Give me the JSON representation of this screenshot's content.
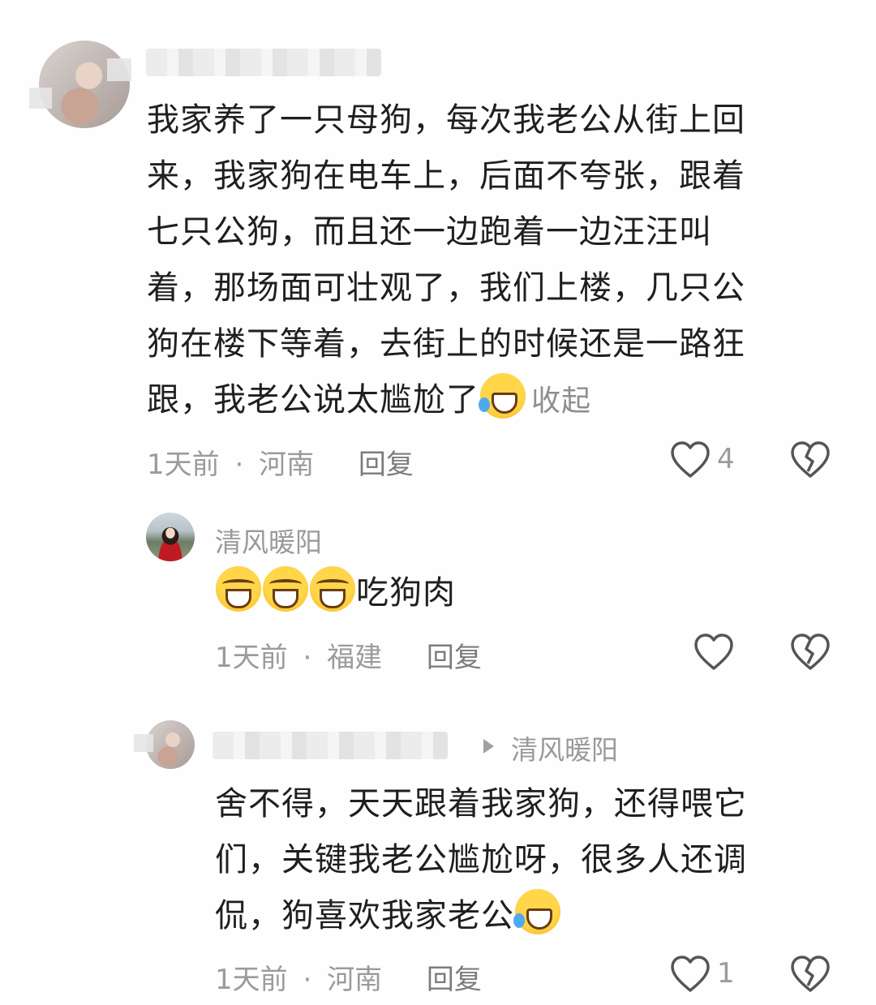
{
  "comments": [
    {
      "text": "我家养了一只母狗，每次我老公从街上回\n来，我家狗在电车上，后面不夸张，跟着\n七只公狗，而且还一边跑着一边汪汪叫\n着，那场面可壮观了，我们上楼，几只公\n狗在楼下等着，去街上的时候还是一路狂\n跟，我老公说太尴尬了",
      "emoji": "cry-laugh",
      "collapse": "收起",
      "time": "1天前",
      "location": "河南",
      "reply": "回复",
      "likes": "4"
    },
    {
      "user": "清风暖阳",
      "emojis": [
        "grin",
        "grin",
        "grin"
      ],
      "text": "吃狗肉",
      "time": "1天前",
      "location": "福建",
      "reply": "回复"
    },
    {
      "reply_to": "清风暖阳",
      "text": "舍不得，天天跟着我家狗，还得喂它\n们，关键我老公尴尬呀，很多人还调\n侃，狗喜欢我家老公",
      "emoji": "cry-laugh",
      "time": "1天前",
      "location": "河南",
      "reply": "回复",
      "likes": "1"
    }
  ],
  "separator": "·",
  "icons": {
    "like": "heart-outline-icon",
    "dislike": "broken-heart-icon",
    "reply_arrow": "triangle-right-icon"
  }
}
